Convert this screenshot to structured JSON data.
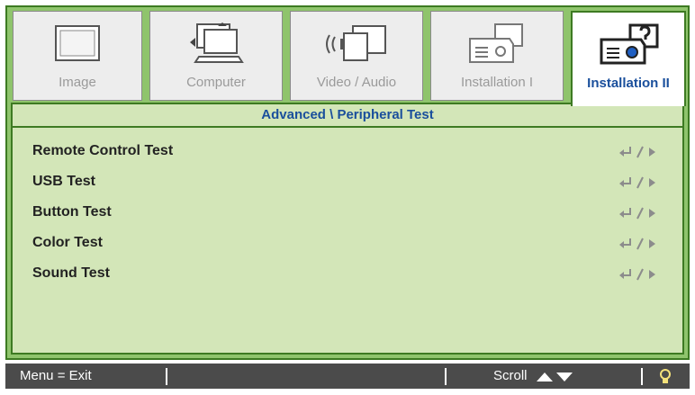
{
  "tabs": [
    {
      "label": "Image",
      "icon": "monitor-icon",
      "active": false
    },
    {
      "label": "Computer",
      "icon": "laptop-icon",
      "active": false
    },
    {
      "label": "Video / Audio",
      "icon": "video-audio-icon",
      "active": false
    },
    {
      "label": "Installation I",
      "icon": "projector-icon",
      "active": false
    },
    {
      "label": "Installation II",
      "icon": "projector-help-icon",
      "active": true
    }
  ],
  "panel": {
    "title": "Advanced \\ Peripheral Test",
    "items": [
      {
        "label": "Remote Control Test",
        "action_icon": "enter-arrow-icon"
      },
      {
        "label": "USB Test",
        "action_icon": "enter-arrow-icon"
      },
      {
        "label": "Button Test",
        "action_icon": "enter-arrow-icon"
      },
      {
        "label": "Color Test",
        "action_icon": "enter-arrow-icon"
      },
      {
        "label": "Sound Test",
        "action_icon": "enter-arrow-icon"
      }
    ]
  },
  "footer": {
    "menu_exit": "Menu = Exit",
    "scroll": "Scroll",
    "scroll_icon": "up-down-triangles-icon",
    "bulb_icon": "lightbulb-icon"
  },
  "colors": {
    "frame": "#8fc46c",
    "border": "#3d7a22",
    "panel": "#d3e6b8",
    "active_label": "#1a4f9c",
    "footer": "#4b4b4b"
  }
}
